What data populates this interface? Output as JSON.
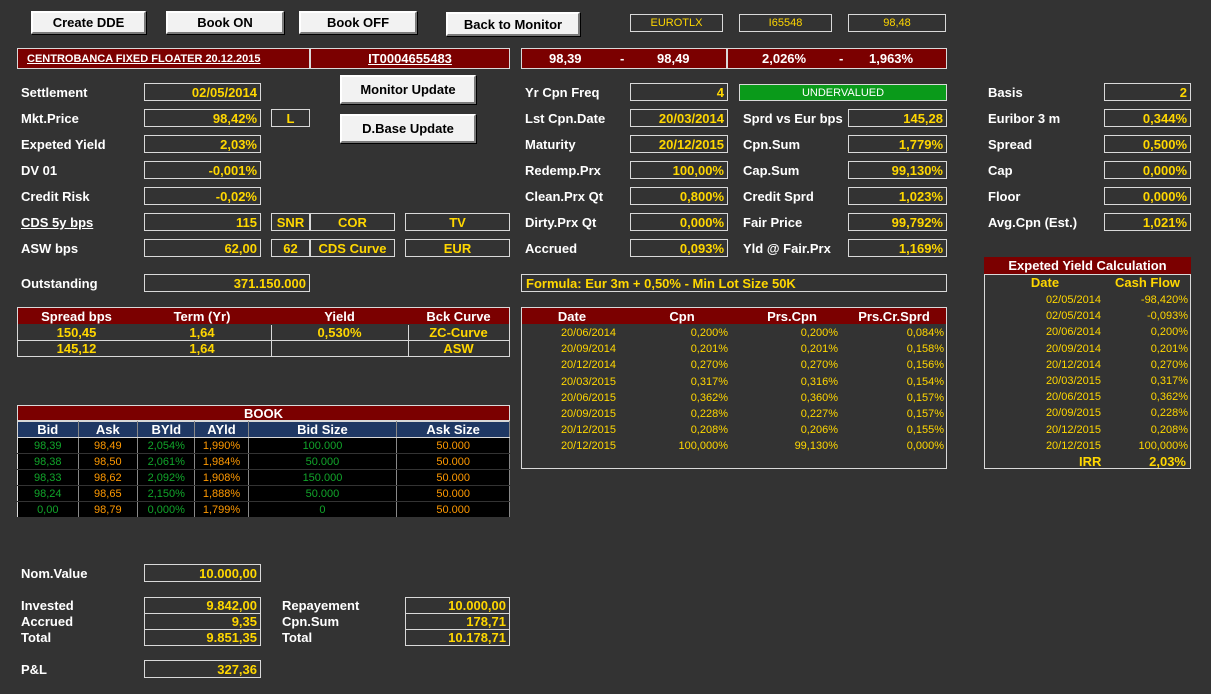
{
  "toolbar": {
    "create_dde": "Create DDE",
    "book_on": "Book ON",
    "book_off": "Book OFF",
    "back_to_monitor": "Back to Monitor",
    "market": "EUROTLX",
    "code": "I65548",
    "last": "98,48"
  },
  "bond": {
    "name": "CENTROBANCA FIXED FLOATER 20.12.2015",
    "isin": "IT0004655483",
    "bid_px": "98,39",
    "ask_px": "98,49",
    "dash1": "-",
    "bid_yld": "2,026%",
    "ask_yld": "1,963%",
    "dash2": "-"
  },
  "buttons": {
    "monitor_update": "Monitor Update",
    "dbase_update": "D.Base Update"
  },
  "left": {
    "settlement_label": "Settlement",
    "settlement": "02/05/2014",
    "mkt_price_label": "Mkt.Price",
    "mkt_price": "98,42%",
    "mkt_price_flag": "L",
    "expeted_yield_label": "Expeted Yield",
    "expeted_yield": "2,03%",
    "dv01_label": "DV 01",
    "dv01": "-0,001%",
    "credit_risk_label": "Credit Risk",
    "credit_risk": "-0,02%",
    "cds_label": "CDS 5y bps",
    "cds": "115",
    "cds_snr": "SNR",
    "cds_cor": "COR",
    "cds_tv": "TV",
    "asw_label": "ASW bps",
    "asw": "62,00",
    "asw_62": "62",
    "cds_curve": "CDS Curve",
    "eur": "EUR",
    "outstanding_label": "Outstanding",
    "outstanding": "371.150.000"
  },
  "middle": {
    "yr_cpn_freq_label": "Yr Cpn Freq",
    "yr_cpn_freq": "4",
    "lst_cpn_date_label": "Lst Cpn.Date",
    "lst_cpn_date": "20/03/2014",
    "maturity_label": "Maturity",
    "maturity": "20/12/2015",
    "redemp_label": "Redemp.Prx",
    "redemp": "100,00%",
    "clean_label": "Clean.Prx Qt",
    "clean": "0,800%",
    "dirty_label": "Dirty.Prx Qt",
    "dirty": "0,000%",
    "accrued_label": "Accrued",
    "accrued": "0,093%",
    "status": "UNDERVALUED",
    "sprd_eur_label": "Sprd vs Eur bps",
    "sprd_eur": "145,28",
    "cpn_sum_label": "Cpn.Sum",
    "cpn_sum": "1,779%",
    "cap_sum_label": "Cap.Sum",
    "cap_sum": "99,130%",
    "credit_sprd_label": "Credit Sprd",
    "credit_sprd": "1,023%",
    "fair_price_label": "Fair Price",
    "fair_price": "99,792%",
    "yld_fair_label": "Yld @ Fair.Prx",
    "yld_fair": "1,169%",
    "formula": "Formula: Eur 3m + 0,50% - Min Lot Size 50K"
  },
  "right": {
    "basis_label": "Basis",
    "basis": "2",
    "euribor_label": "Euribor 3 m",
    "euribor": "0,344%",
    "spread_label": "Spread",
    "spread": "0,500%",
    "cap_label": "Cap",
    "cap": "0,000%",
    "floor_label": "Floor",
    "floor": "0,000%",
    "avg_cpn_label": "Avg.Cpn (Est.)",
    "avg_cpn": "1,021%"
  },
  "spread_table": {
    "headers": [
      "Spread bps",
      "Term (Yr)",
      "Yield",
      "Bck Curve"
    ],
    "rows": [
      [
        "150,45",
        "1,64",
        "0,530%",
        "ZC-Curve"
      ],
      [
        "145,12",
        "1,64",
        "",
        "ASW"
      ]
    ]
  },
  "coupon_table": {
    "headers": [
      "Date",
      "Cpn",
      "Prs.Cpn",
      "Prs.Cr.Sprd"
    ],
    "rows": [
      [
        "20/06/2014",
        "0,200%",
        "0,200%",
        "0,084%"
      ],
      [
        "20/09/2014",
        "0,201%",
        "0,201%",
        "0,158%"
      ],
      [
        "20/12/2014",
        "0,270%",
        "0,270%",
        "0,156%"
      ],
      [
        "20/03/2015",
        "0,317%",
        "0,316%",
        "0,154%"
      ],
      [
        "20/06/2015",
        "0,362%",
        "0,360%",
        "0,157%"
      ],
      [
        "20/09/2015",
        "0,228%",
        "0,227%",
        "0,157%"
      ],
      [
        "20/12/2015",
        "0,208%",
        "0,206%",
        "0,155%"
      ],
      [
        "20/12/2015",
        "100,000%",
        "99,130%",
        "0,000%"
      ]
    ]
  },
  "yield_calc": {
    "title": "Expeted Yield Calculation",
    "headers": [
      "Date",
      "Cash Flow"
    ],
    "rows": [
      [
        "02/05/2014",
        "-98,420%"
      ],
      [
        "02/05/2014",
        "-0,093%"
      ],
      [
        "20/06/2014",
        "0,200%"
      ],
      [
        "20/09/2014",
        "0,201%"
      ],
      [
        "20/12/2014",
        "0,270%"
      ],
      [
        "20/03/2015",
        "0,317%"
      ],
      [
        "20/06/2015",
        "0,362%"
      ],
      [
        "20/09/2015",
        "0,228%"
      ],
      [
        "20/12/2015",
        "0,208%"
      ],
      [
        "20/12/2015",
        "100,000%"
      ]
    ],
    "irr_label": "IRR",
    "irr": "2,03%"
  },
  "book": {
    "title": "BOOK",
    "headers": [
      "Bid",
      "Ask",
      "BYld",
      "AYld",
      "Bid Size",
      "Ask Size"
    ],
    "rows": [
      [
        "98,39",
        "98,49",
        "2,054%",
        "1,990%",
        "100.000",
        "50.000"
      ],
      [
        "98,38",
        "98,50",
        "2,061%",
        "1,984%",
        "50.000",
        "50.000"
      ],
      [
        "98,33",
        "98,62",
        "2,092%",
        "1,908%",
        "150.000",
        "50.000"
      ],
      [
        "98,24",
        "98,65",
        "2,150%",
        "1,888%",
        "50.000",
        "50.000"
      ],
      [
        "0,00",
        "98,79",
        "0,000%",
        "1,799%",
        "0",
        "50.000"
      ]
    ]
  },
  "pnl": {
    "nom_value_label": "Nom.Value",
    "nom_value": "10.000,00",
    "invested_label": "Invested",
    "invested": "9.842,00",
    "accrued_label": "Accrued",
    "accrued": "9,35",
    "total_label": "Total",
    "total": "9.851,35",
    "repayement_label": "Repayement",
    "repayement": "10.000,00",
    "cpn_sum_label": "Cpn.Sum",
    "cpn_sum": "178,71",
    "total2_label": "Total",
    "total2": "10.178,71",
    "pl_label": "P&L",
    "pl": "327,36"
  }
}
